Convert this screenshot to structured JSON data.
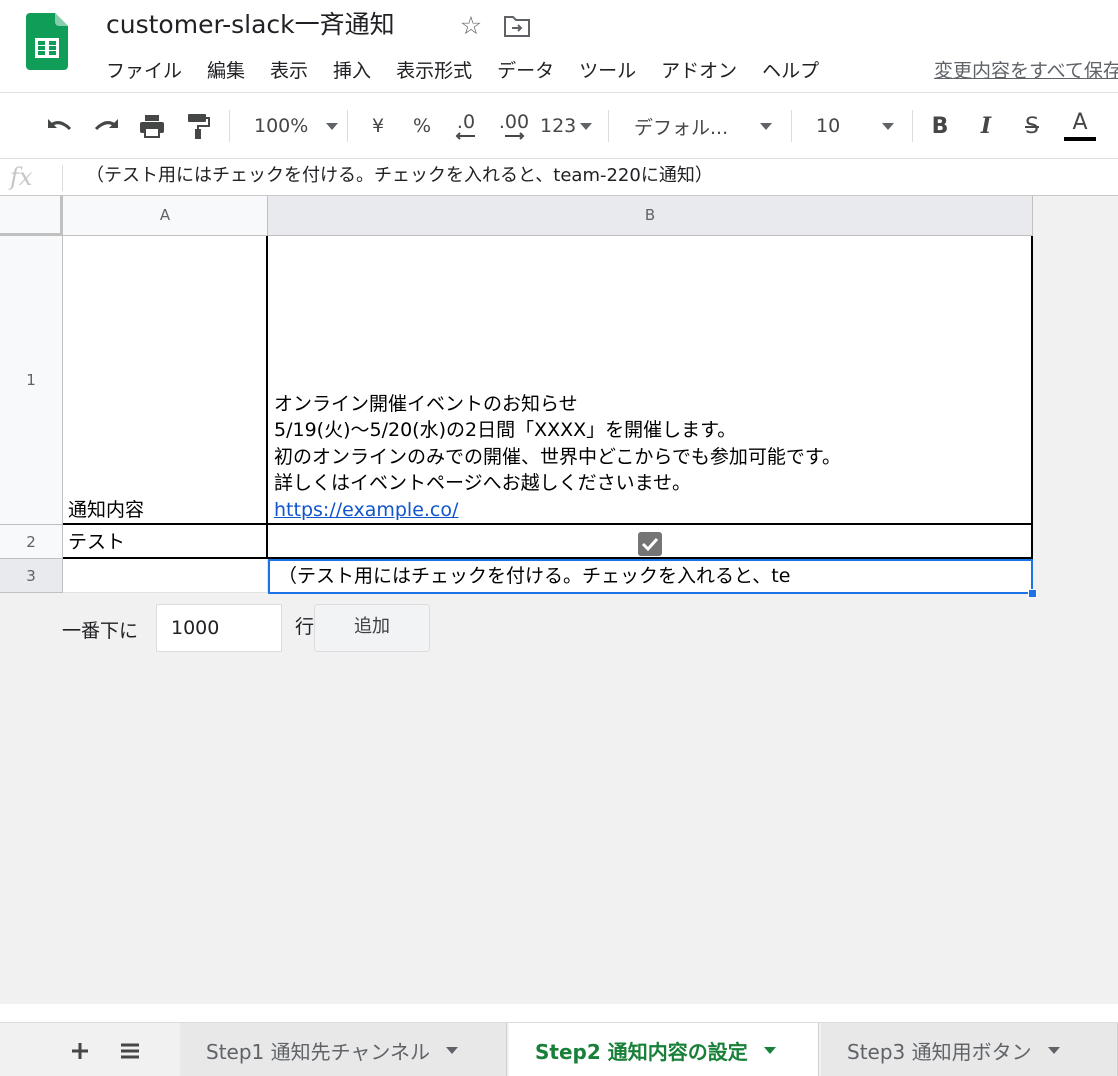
{
  "app": {
    "title": "customer-slack一斉通知"
  },
  "menu": {
    "items": [
      "ファイル",
      "編集",
      "表示",
      "挿入",
      "表示形式",
      "データ",
      "ツール",
      "アドオン",
      "ヘルプ"
    ],
    "changes_link": "変更内容をすべて保存しました"
  },
  "toolbar": {
    "zoom": "100%",
    "currency": "¥",
    "percent": "%",
    "decimal_decrease": ".0",
    "decimal_increase": ".00",
    "number_format": "123",
    "font": "デフォル...",
    "font_size": "10",
    "bold": "B",
    "italic": "I",
    "strikethrough": "S",
    "text_color": "A"
  },
  "formula_bar": {
    "icon": "fx",
    "content": "（テスト用にはチェックを付ける。チェックを入れると、team-220に通知）"
  },
  "columns": [
    "A",
    "B"
  ],
  "rows": [
    "1",
    "2",
    "3"
  ],
  "cells": {
    "a1": "通知内容",
    "b1": [
      "オンライン開催イベントのお知らせ",
      "5/19(火)〜5/20(水)の2日間「XXXX」を開催します。",
      "初のオンラインのみでの開催、世界中どこからでも参加可能です。",
      "詳しくはイベントページへお越しくださいませ。",
      "https://example.co/"
    ],
    "a2": "テスト",
    "b2_checked": true,
    "b3": "（テスト用にはチェックを付ける。チェックを入れると、te"
  },
  "add_rows": {
    "prefix": "一番下に",
    "value": "1000",
    "suffix": "行",
    "button": "追加"
  },
  "sheet_tabs": [
    {
      "label": "Step1 通知先チャンネル",
      "active": false
    },
    {
      "label": "Step2 通知内容の設定",
      "active": true
    },
    {
      "label": "Step3 通知用ボタン",
      "active": false
    }
  ],
  "colors": {
    "accent": "#1a73e8",
    "sheets_green": "#0f9d58",
    "active_tab": "#188038",
    "link": "#1155cc"
  }
}
